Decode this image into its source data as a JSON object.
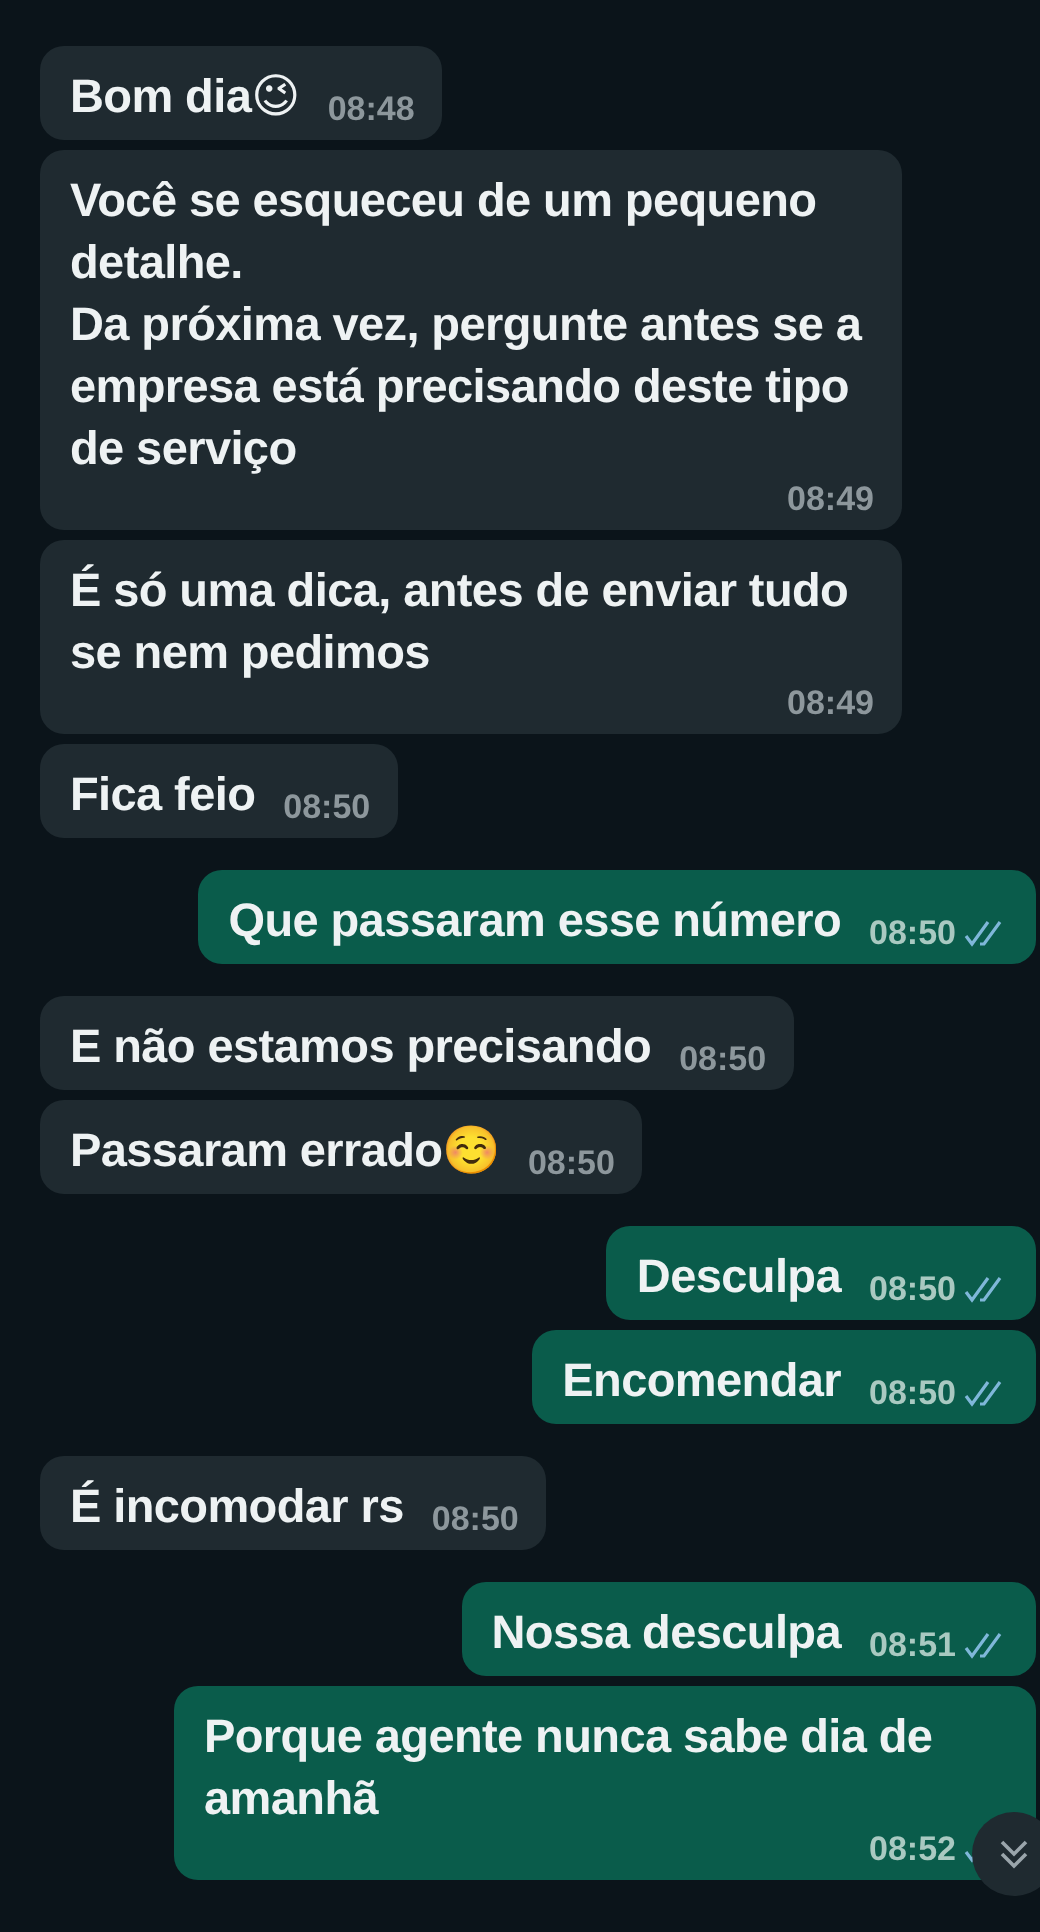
{
  "messages": [
    {
      "kind": "incoming",
      "text": "Bom dia😉",
      "time": "08:48"
    },
    {
      "kind": "incoming",
      "text": "Você se esqueceu de um pequeno detalhe.\nDa próxima vez, pergunte antes se a empresa está precisando deste tipo de serviço",
      "time": "08:49"
    },
    {
      "kind": "incoming",
      "text": "É só uma dica, antes de enviar tudo se nem pedimos",
      "time": "08:49"
    },
    {
      "kind": "incoming",
      "text": "Fica feio",
      "time": "08:50"
    },
    {
      "kind": "outgoing",
      "text": "Que passaram esse número",
      "time": "08:50"
    },
    {
      "kind": "incoming",
      "text": "E não estamos precisando",
      "time": "08:50"
    },
    {
      "kind": "incoming",
      "text": "Passaram errado☺️",
      "time": "08:50"
    },
    {
      "kind": "outgoing",
      "text": "Desculpa",
      "time": "08:50"
    },
    {
      "kind": "outgoing",
      "text": "Encomendar",
      "time": "08:50"
    },
    {
      "kind": "incoming",
      "text": "É incomodar rs",
      "time": "08:50"
    },
    {
      "kind": "outgoing",
      "text": "Nossa desculpa",
      "time": "08:51"
    },
    {
      "kind": "outgoing",
      "text": "Porque agente nunca sabe dia de amanhã",
      "time": "08:52"
    }
  ]
}
